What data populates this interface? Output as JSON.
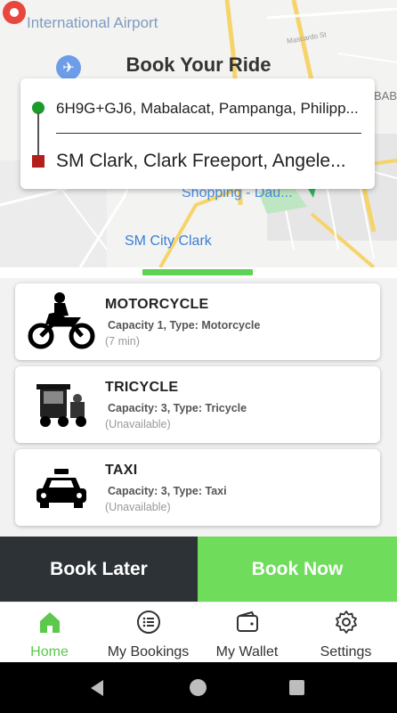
{
  "screen_title": "Book Your Ride",
  "map": {
    "labels": {
      "airport": "International Airport",
      "shopping": "Shopping - Dau...",
      "sm_city": "SM City Clark",
      "baba": "BABA",
      "road": "Mascardo St"
    }
  },
  "route": {
    "origin": "6H9G+GJ6, Mabalacat, Pampanga, Philipp...",
    "destination": "SM Clark, Clark Freeport, Angele..."
  },
  "vehicles": [
    {
      "name": "MOTORCYCLE",
      "details": "Capacity 1, Type: Motorcycle",
      "status": "(7 min)",
      "icon": "motorcycle-icon"
    },
    {
      "name": "TRICYCLE",
      "details": "Capacity: 3, Type: Tricycle",
      "status": "(Unavailable)",
      "icon": "tricycle-icon"
    },
    {
      "name": "TAXI",
      "details": "Capacity: 3, Type: Taxi",
      "status": "(Unavailable)",
      "icon": "taxi-icon"
    }
  ],
  "actions": {
    "book_later": "Book Later",
    "book_now": "Book Now"
  },
  "bottom_nav": [
    {
      "label": "Home",
      "icon": "home-icon",
      "active": true
    },
    {
      "label": "My Bookings",
      "icon": "list-icon",
      "active": false
    },
    {
      "label": "My Wallet",
      "icon": "wallet-icon",
      "active": false
    },
    {
      "label": "Settings",
      "icon": "gear-icon",
      "active": false
    }
  ],
  "colors": {
    "accent_green": "#6fdc5c",
    "dark_button": "#2c3235",
    "origin_marker": "#1a9b2a",
    "destination_marker": "#b3201c",
    "active_nav": "#5cc84c"
  }
}
